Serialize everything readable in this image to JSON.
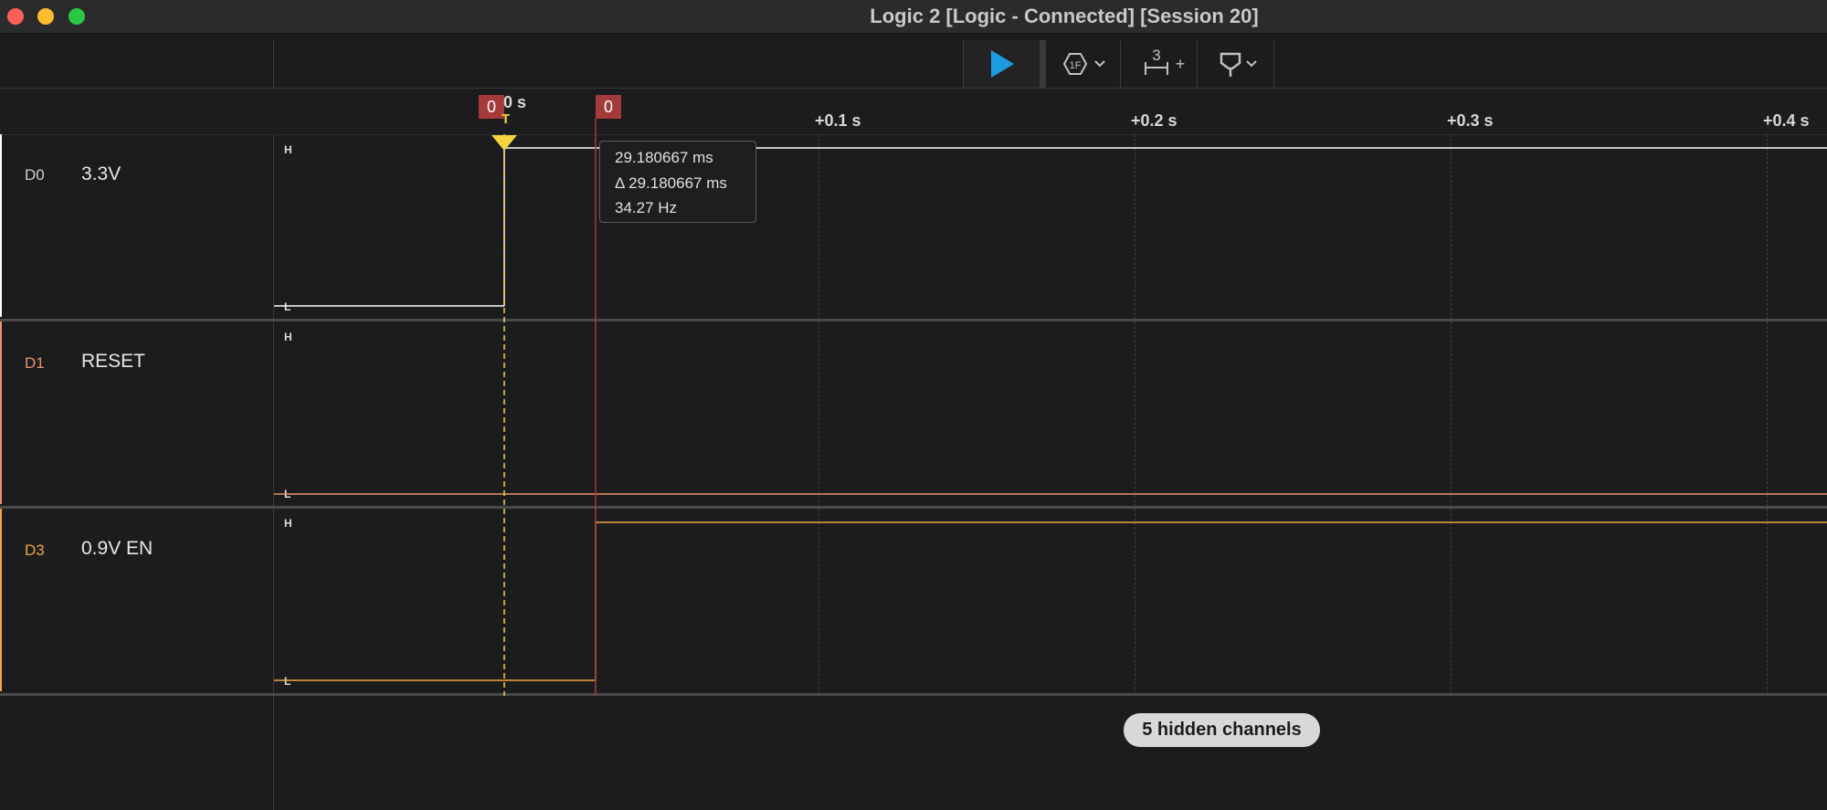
{
  "window": {
    "title": "Logic 2 [Logic - Connected] [Session 20]",
    "traffic_lights": {
      "close": "#ff5f57",
      "minimize": "#febc2e",
      "zoom": "#28c840"
    }
  },
  "toolbar": {
    "play_icon": "play-icon",
    "trigger_icon": "trigger-hexagon-icon",
    "trigger_label": "1F",
    "measure_count": "3",
    "measure_add": "+",
    "marker_icon": "marker-flag-icon"
  },
  "ruler": {
    "zero_label": "0 s",
    "trigger_letter": "T",
    "ticks": [
      "+0.1 s",
      "+0.2 s",
      "+0.3 s",
      "+0.4 s"
    ],
    "markers": [
      "0",
      "0"
    ]
  },
  "channels": [
    {
      "id": "D0",
      "name": "3.3V",
      "color": "#ffffff",
      "high": "H",
      "low": "L"
    },
    {
      "id": "D1",
      "name": "RESET",
      "color": "#e8936b",
      "high": "H",
      "low": "L"
    },
    {
      "id": "D3",
      "name": "0.9V EN",
      "color": "#f0a640",
      "high": "H",
      "low": "L"
    }
  ],
  "measurement": {
    "time": "29.180667 ms",
    "delta": "Δ 29.180667 ms",
    "freq": "34.27 Hz"
  },
  "hidden_channels": "5 hidden channels",
  "colors": {
    "background": "#1c1c1e",
    "accent_play": "#1e9be0",
    "trigger_marker": "#f5d442",
    "time_marker": "#a53a3a"
  }
}
